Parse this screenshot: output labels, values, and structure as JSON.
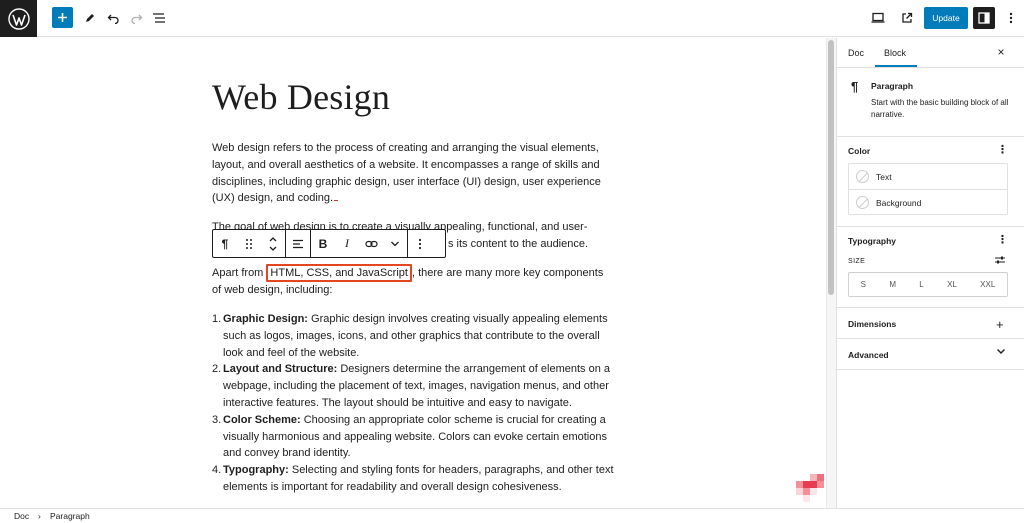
{
  "toolbar": {
    "update_label": "Update",
    "icons": [
      "wordpress-logo-icon",
      "plus-icon",
      "pencil-icon",
      "undo-icon",
      "redo-icon",
      "list-view-icon",
      "desktop-preview-icon",
      "external-link-icon",
      "settings-panel-icon",
      "kebab-menu-icon"
    ],
    "accent_color": "#007cba"
  },
  "editor": {
    "title": "Web Design",
    "paragraph1": "Web design refers to the process of creating and arranging the visual elements, layout, and overall aesthetics of a website. It encompasses a range of skills and disciplines, including graphic design, user interface (UI) design, user experience (UX) design, and coding.",
    "paragraph2_start": "The goal of web design is to create a visually appealing, functional, and user-",
    "paragraph2_end": "s its content to the audience.",
    "paragraph3_before": "Apart from ",
    "paragraph3_highlight": "HTML, CSS, and JavaScript",
    "paragraph3_after": ", there are many more key components of web design, including:",
    "highlight_color": "#e2471f",
    "list": [
      {
        "num": "1.",
        "term": "Graphic Design:",
        "text": " Graphic design involves creating visually appealing elements such as logos, images, icons, and other graphics that contribute to the overall look and feel of the website."
      },
      {
        "num": "2.",
        "term": "Layout and Structure:",
        "text": " Designers determine the arrangement of elements on a webpage, including the placement of text, images, navigation menus, and other interactive features. The layout should be intuitive and easy to navigate."
      },
      {
        "num": "3.",
        "term": "Color Scheme:",
        "text": " Choosing an appropriate color scheme is crucial for creating a visually harmonious and appealing website. Colors can evoke certain emotions and convey brand identity."
      },
      {
        "num": "4.",
        "term": "Typography:",
        "text": " Selecting and styling fonts for headers, paragraphs, and other text elements is important for readability and overall design cohesiveness."
      }
    ]
  },
  "block_toolbar": {
    "pilcrow": "¶",
    "bold": "B",
    "italic": "I"
  },
  "sidebar": {
    "tab_doc": "Doc",
    "tab_block": "Block",
    "close": "×",
    "block_name": "Paragraph",
    "block_desc": "Start with the basic building block of all narrative.",
    "pilcrow": "¶",
    "color_title": "Color",
    "color_text": "Text",
    "color_background": "Background",
    "typography_title": "Typography",
    "size_label": "SIZE",
    "sizes": [
      "S",
      "M",
      "L",
      "XL",
      "XXL"
    ],
    "dimensions_title": "Dimensions",
    "advanced_title": "Advanced",
    "kebab": "⋮",
    "plus": "+"
  },
  "footer": {
    "crumb_doc": "Doc",
    "crumb_sep": "›",
    "crumb_paragraph": "Paragraph"
  }
}
